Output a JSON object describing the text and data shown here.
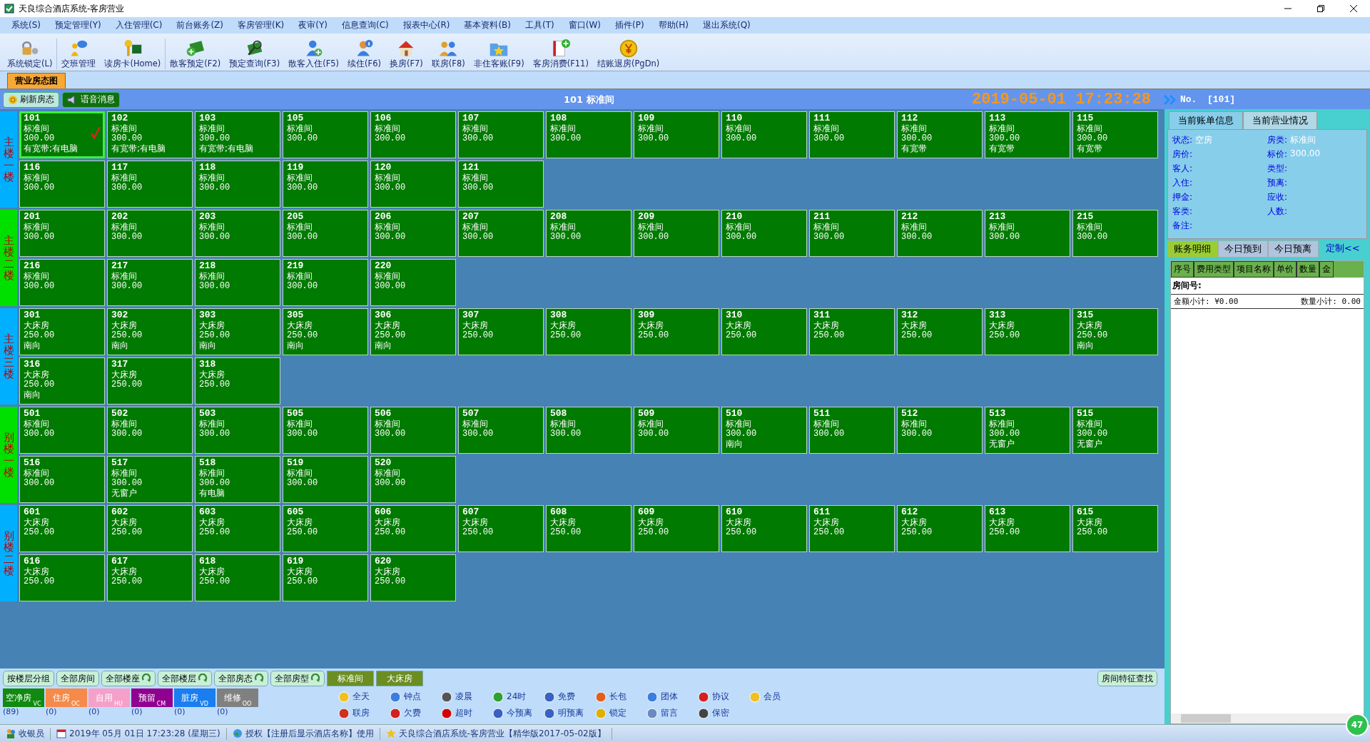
{
  "window": {
    "title": "天良综合酒店系统-客房营业"
  },
  "menu": [
    "系统(S)",
    "预定管理(Y)",
    "入住管理(C)",
    "前台账务(Z)",
    "客房管理(K)",
    "夜审(Y)",
    "信息查询(C)",
    "报表中心(R)",
    "基本资料(B)",
    "工具(T)",
    "窗口(W)",
    "插件(P)",
    "帮助(H)",
    "退出系统(Q)"
  ],
  "toolbar": [
    "系统锁定(L)",
    "交班管理",
    "读房卡(Home)",
    "散客预定(F2)",
    "预定查询(F3)",
    "散客入住(F5)",
    "续住(F6)",
    "换房(F7)",
    "联房(F8)",
    "非住客账(F9)",
    "客房消费(F11)",
    "结账退房(PgDn)"
  ],
  "doc_tab": "营业房态图",
  "header": {
    "buttons": [
      "刷新房态",
      "语音消息"
    ],
    "room_title": "101 标准间",
    "datetime": "2019-05-01 17:23:28",
    "no_label": "No.",
    "no_value": "[101]"
  },
  "floors": [
    {
      "label": "主楼一楼",
      "rooms": [
        {
          "number": "101",
          "type": "标准间",
          "price": "300.00",
          "note": "有宽带;有电脑",
          "selected": true
        },
        {
          "number": "102",
          "type": "标准间",
          "price": "300.00",
          "note": "有宽带;有电脑",
          "selected": false
        },
        {
          "number": "103",
          "type": "标准间",
          "price": "300.00",
          "note": "有宽带;有电脑",
          "selected": false
        },
        {
          "number": "105",
          "type": "标准间",
          "price": "300.00",
          "selected": false
        },
        {
          "number": "106",
          "type": "标准间",
          "price": "300.00",
          "selected": false
        },
        {
          "number": "107",
          "type": "标准间",
          "price": "300.00",
          "selected": false
        },
        {
          "number": "108",
          "type": "标准间",
          "price": "300.00",
          "selected": false
        },
        {
          "number": "109",
          "type": "标准间",
          "price": "300.00",
          "selected": false
        },
        {
          "number": "110",
          "type": "标准间",
          "price": "300.00",
          "selected": false
        },
        {
          "number": "111",
          "type": "标准间",
          "price": "300.00",
          "selected": false
        },
        {
          "number": "112",
          "type": "标准间",
          "price": "300.00",
          "note": "有宽带",
          "selected": false
        },
        {
          "number": "113",
          "type": "标准间",
          "price": "300.00",
          "note": "有宽带",
          "selected": false
        },
        {
          "number": "115",
          "type": "标准间",
          "price": "300.00",
          "note": "有宽带",
          "selected": false
        },
        {
          "number": "116",
          "type": "标准间",
          "price": "300.00",
          "selected": false
        },
        {
          "number": "117",
          "type": "标准间",
          "price": "300.00",
          "selected": false
        },
        {
          "number": "118",
          "type": "标准间",
          "price": "300.00",
          "selected": false
        },
        {
          "number": "119",
          "type": "标准间",
          "price": "300.00",
          "selected": false
        },
        {
          "number": "120",
          "type": "标准间",
          "price": "300.00",
          "selected": false
        },
        {
          "number": "121",
          "type": "标准间",
          "price": "300.00",
          "selected": false
        }
      ]
    },
    {
      "label": "主楼二楼",
      "rooms": [
        {
          "number": "201",
          "type": "标准间",
          "price": "300.00",
          "selected": false
        },
        {
          "number": "202",
          "type": "标准间",
          "price": "300.00",
          "selected": false
        },
        {
          "number": "203",
          "type": "标准间",
          "price": "300.00",
          "selected": false
        },
        {
          "number": "205",
          "type": "标准间",
          "price": "300.00",
          "selected": false
        },
        {
          "number": "206",
          "type": "标准间",
          "price": "300.00",
          "selected": false
        },
        {
          "number": "207",
          "type": "标准间",
          "price": "300.00",
          "selected": false
        },
        {
          "number": "208",
          "type": "标准间",
          "price": "300.00",
          "selected": false
        },
        {
          "number": "209",
          "type": "标准间",
          "price": "300.00",
          "selected": false
        },
        {
          "number": "210",
          "type": "标准间",
          "price": "300.00",
          "selected": false
        },
        {
          "number": "211",
          "type": "标准间",
          "price": "300.00",
          "selected": false
        },
        {
          "number": "212",
          "type": "标准间",
          "price": "300.00",
          "selected": false
        },
        {
          "number": "213",
          "type": "标准间",
          "price": "300.00",
          "selected": false
        },
        {
          "number": "215",
          "type": "标准间",
          "price": "300.00",
          "selected": false
        },
        {
          "number": "216",
          "type": "标准间",
          "price": "300.00",
          "selected": false
        },
        {
          "number": "217",
          "type": "标准间",
          "price": "300.00",
          "selected": false
        },
        {
          "number": "218",
          "type": "标准间",
          "price": "300.00",
          "selected": false
        },
        {
          "number": "219",
          "type": "标准间",
          "price": "300.00",
          "selected": false
        },
        {
          "number": "220",
          "type": "标准间",
          "price": "300.00",
          "selected": false
        }
      ]
    },
    {
      "label": "主楼三楼",
      "rooms": [
        {
          "number": "301",
          "type": "大床房",
          "price": "250.00",
          "note": "南向",
          "selected": false
        },
        {
          "number": "302",
          "type": "大床房",
          "price": "250.00",
          "note": "南向",
          "selected": false
        },
        {
          "number": "303",
          "type": "大床房",
          "price": "250.00",
          "note": "南向",
          "selected": false
        },
        {
          "number": "305",
          "type": "大床房",
          "price": "250.00",
          "note": "南向",
          "selected": false
        },
        {
          "number": "306",
          "type": "大床房",
          "price": "250.00",
          "note": "南向",
          "selected": false
        },
        {
          "number": "307",
          "type": "大床房",
          "price": "250.00",
          "selected": false
        },
        {
          "number": "308",
          "type": "大床房",
          "price": "250.00",
          "selected": false
        },
        {
          "number": "309",
          "type": "大床房",
          "price": "250.00",
          "selected": false
        },
        {
          "number": "310",
          "type": "大床房",
          "price": "250.00",
          "selected": false
        },
        {
          "number": "311",
          "type": "大床房",
          "price": "250.00",
          "selected": false
        },
        {
          "number": "312",
          "type": "大床房",
          "price": "250.00",
          "selected": false
        },
        {
          "number": "313",
          "type": "大床房",
          "price": "250.00",
          "selected": false
        },
        {
          "number": "315",
          "type": "大床房",
          "price": "250.00",
          "note": "南向",
          "selected": false
        },
        {
          "number": "316",
          "type": "大床房",
          "price": "250.00",
          "note": "南向",
          "selected": false
        },
        {
          "number": "317",
          "type": "大床房",
          "price": "250.00",
          "selected": false
        },
        {
          "number": "318",
          "type": "大床房",
          "price": "250.00",
          "selected": false
        }
      ]
    },
    {
      "label": "别楼一楼",
      "rooms": [
        {
          "number": "501",
          "type": "标准间",
          "price": "300.00",
          "selected": false
        },
        {
          "number": "502",
          "type": "标准间",
          "price": "300.00",
          "selected": false
        },
        {
          "number": "503",
          "type": "标准间",
          "price": "300.00",
          "selected": false
        },
        {
          "number": "505",
          "type": "标准间",
          "price": "300.00",
          "selected": false
        },
        {
          "number": "506",
          "type": "标准间",
          "price": "300.00",
          "selected": false
        },
        {
          "number": "507",
          "type": "标准间",
          "price": "300.00",
          "selected": false
        },
        {
          "number": "508",
          "type": "标准间",
          "price": "300.00",
          "selected": false
        },
        {
          "number": "509",
          "type": "标准间",
          "price": "300.00",
          "selected": false
        },
        {
          "number": "510",
          "type": "标准间",
          "price": "300.00",
          "note": "南向",
          "selected": false
        },
        {
          "number": "511",
          "type": "标准间",
          "price": "300.00",
          "selected": false
        },
        {
          "number": "512",
          "type": "标准间",
          "price": "300.00",
          "selected": false
        },
        {
          "number": "513",
          "type": "标准间",
          "price": "300.00",
          "note": "无窗户",
          "selected": false
        },
        {
          "number": "515",
          "type": "标准间",
          "price": "300.00",
          "note": "无窗户",
          "selected": false
        },
        {
          "number": "516",
          "type": "标准间",
          "price": "300.00",
          "selected": false
        },
        {
          "number": "517",
          "type": "标准间",
          "price": "300.00",
          "note": "无窗户",
          "selected": false
        },
        {
          "number": "518",
          "type": "标准间",
          "price": "300.00",
          "note": "有电脑",
          "selected": false
        },
        {
          "number": "519",
          "type": "标准间",
          "price": "300.00",
          "selected": false
        },
        {
          "number": "520",
          "type": "标准间",
          "price": "300.00",
          "selected": false
        }
      ]
    },
    {
      "label": "别楼二楼",
      "rooms": [
        {
          "number": "601",
          "type": "大床房",
          "price": "250.00",
          "selected": false
        },
        {
          "number": "602",
          "type": "大床房",
          "price": "250.00",
          "selected": false
        },
        {
          "number": "603",
          "type": "大床房",
          "price": "250.00",
          "selected": false
        },
        {
          "number": "605",
          "type": "大床房",
          "price": "250.00",
          "selected": false
        },
        {
          "number": "606",
          "type": "大床房",
          "price": "250.00",
          "selected": false
        },
        {
          "number": "607",
          "type": "大床房",
          "price": "250.00",
          "selected": false
        },
        {
          "number": "608",
          "type": "大床房",
          "price": "250.00",
          "selected": false
        },
        {
          "number": "609",
          "type": "大床房",
          "price": "250.00",
          "selected": false
        },
        {
          "number": "610",
          "type": "大床房",
          "price": "250.00",
          "selected": false
        },
        {
          "number": "611",
          "type": "大床房",
          "price": "250.00",
          "selected": false
        },
        {
          "number": "612",
          "type": "大床房",
          "price": "250.00",
          "selected": false
        },
        {
          "number": "613",
          "type": "大床房",
          "price": "250.00",
          "selected": false
        },
        {
          "number": "615",
          "type": "大床房",
          "price": "250.00",
          "selected": false
        },
        {
          "number": "616",
          "type": "大床房",
          "price": "250.00",
          "selected": false
        },
        {
          "number": "617",
          "type": "大床房",
          "price": "250.00",
          "selected": false
        },
        {
          "number": "618",
          "type": "大床房",
          "price": "250.00",
          "selected": false
        },
        {
          "number": "619",
          "type": "大床房",
          "price": "250.00",
          "selected": false
        },
        {
          "number": "620",
          "type": "大床房",
          "price": "250.00",
          "selected": false
        }
      ]
    }
  ],
  "filters": [
    {
      "label": "按楼层分组",
      "kind": "plain"
    },
    {
      "label": "全部房间",
      "kind": "plain"
    },
    {
      "label": "全部楼座",
      "kind": "dropdown"
    },
    {
      "label": "全部楼层",
      "kind": "dropdown"
    },
    {
      "label": "全部房态",
      "kind": "dropdown"
    },
    {
      "label": "全部房型",
      "kind": "dropdown"
    },
    {
      "label": "标准间",
      "kind": "type"
    },
    {
      "label": "大床房",
      "kind": "type"
    }
  ],
  "feature_search": "房间特征查找",
  "statuses": [
    {
      "label": "空净房",
      "code": "VC",
      "count": "(89)",
      "color": "#108a10"
    },
    {
      "label": "住房",
      "code": "OC",
      "count": "(0)",
      "color": "#f58a4a"
    },
    {
      "label": "自用",
      "code": "HU",
      "count": "(0)",
      "color": "#f5a0c8"
    },
    {
      "label": "预留",
      "code": "CM",
      "count": "(0)",
      "color": "#900090"
    },
    {
      "label": "脏房",
      "code": "VD",
      "count": "(0)",
      "color": "#1a7ef0"
    },
    {
      "label": "维修",
      "code": "OO",
      "count": "(0)",
      "color": "#808080"
    }
  ],
  "features": [
    "全天",
    "钟点",
    "凌晨",
    "24时",
    "免费",
    "长包",
    "团体",
    "协议",
    "会员",
    "联房",
    "欠费",
    "超时",
    "今预离",
    "明预离",
    "锁定",
    "留言",
    "保密"
  ],
  "detail_panel": {
    "tabs": [
      {
        "label": "当前账单信息",
        "selected": true
      },
      {
        "label": "当前营业情况",
        "selected": false
      }
    ],
    "fields": [
      {
        "label": "状态:",
        "value": "空房"
      },
      {
        "label": "房类:",
        "value": "标准间"
      },
      {
        "label": "房价:"
      },
      {
        "label": "标价:",
        "value": "300.00"
      },
      {
        "label": "客人:"
      },
      {
        "label": "类型:"
      },
      {
        "label": "入住:"
      },
      {
        "label": "预离:"
      },
      {
        "label": "押金:"
      },
      {
        "label": "应收:"
      },
      {
        "label": "客类:"
      },
      {
        "label": "人数:"
      },
      {
        "label": "备注:"
      }
    ],
    "subtabs": [
      {
        "label": "账务明细",
        "selected": true
      },
      {
        "label": "今日预到",
        "selected": false
      },
      {
        "label": "今日预离",
        "selected": false
      }
    ],
    "custom_link": "定制<<",
    "table": {
      "columns": [
        "序号",
        "费用类型",
        "项目名称",
        "单价",
        "数量",
        "金"
      ],
      "group_row": "房间号:",
      "summary": [
        {
          "label": "金额小计:",
          "value": "¥0.00"
        },
        {
          "label": "数量小计:",
          "value": "0.00"
        }
      ]
    }
  },
  "status_bar": [
    "收银员",
    "2019年 05月 01日 17:23:28 (星期三)",
    "授权【注册后显示酒店名称】使用",
    "天良综合酒店系统-客房营业【精华版2017-05-02版】"
  ],
  "badge": "47"
}
